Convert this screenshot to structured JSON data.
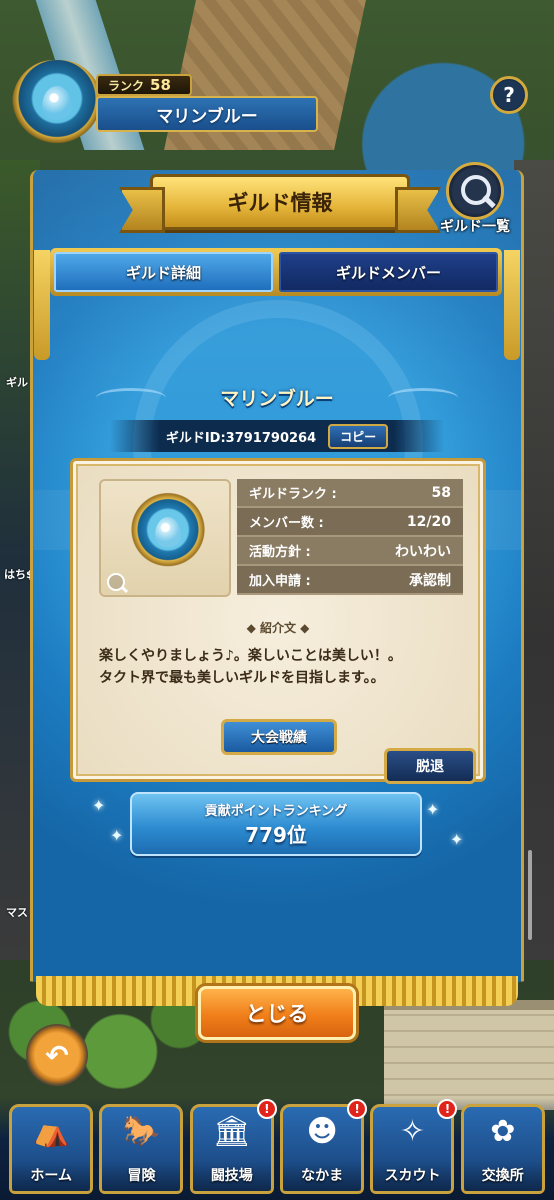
{
  "player": {
    "rank_label": "ランク",
    "rank_value": "58",
    "name": "マリンブルー"
  },
  "header": {
    "help_symbol": "?",
    "title": "ギルド情報",
    "guild_list_label": "ギルド一覧"
  },
  "tabs": [
    {
      "label": "ギルド詳細",
      "active": true
    },
    {
      "label": "ギルドメンバー",
      "active": false
    }
  ],
  "guild": {
    "name": "マリンブルー",
    "id_text": "ギルドID:3791790264",
    "copy_label": "コピー",
    "stats": [
      {
        "label": "ギルドランク :",
        "value": "58"
      },
      {
        "label": "メンバー数 :",
        "value": "12/20"
      },
      {
        "label": "活動方針 :",
        "value": "わいわい"
      },
      {
        "label": "加入申請 :",
        "value": "承認制"
      }
    ],
    "intro_heading": "紹介文",
    "intro_text_line1": "楽しくやりましょう♪。楽しいことは美しい！。",
    "intro_text_line2": "タクト界で最も美しいギルドを目指します。。",
    "results_label": "大会戦績",
    "leave_label": "脱退"
  },
  "ranking": {
    "label": "貢献ポイントランキング",
    "value": "779位"
  },
  "close_label": "とじる",
  "background_text": {
    "left1": "はち$",
    "left2": "ギル",
    "left3": "マス"
  },
  "bottom_nav": [
    {
      "label": "ホーム",
      "icon": "tent-icon",
      "alert": false
    },
    {
      "label": "冒険",
      "icon": "wagon-icon",
      "alert": false
    },
    {
      "label": "闘技場",
      "icon": "arena-icon",
      "alert": true
    },
    {
      "label": "なかま",
      "icon": "party-icon",
      "alert": true
    },
    {
      "label": "スカウト",
      "icon": "scout-icon",
      "alert": true
    },
    {
      "label": "交換所",
      "icon": "exchange-icon",
      "alert": false
    }
  ],
  "alert_symbol": "!",
  "colors": {
    "banner_blue": "#1d7cc1",
    "gold": "#c9a13d",
    "close_orange": "#f07f1a",
    "parchment": "#f6eedd"
  }
}
